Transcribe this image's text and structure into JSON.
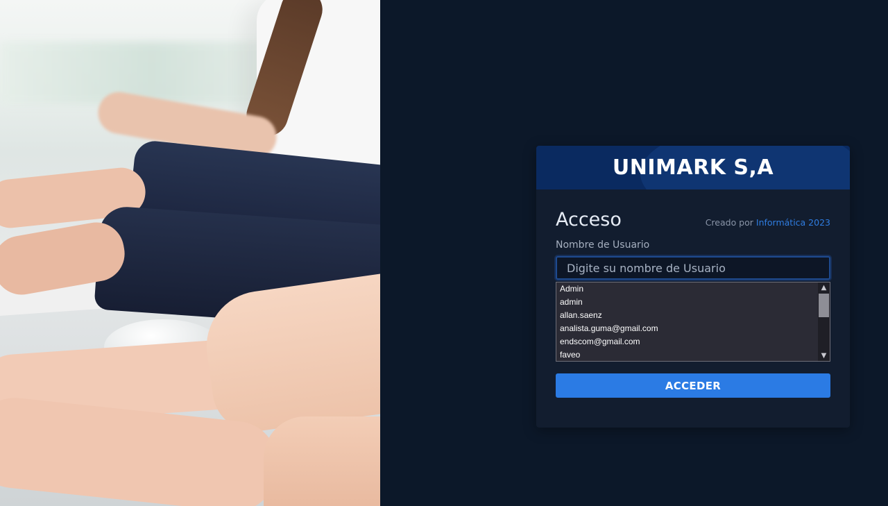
{
  "photo": {
    "description_icon": "office-typing-photo"
  },
  "card": {
    "brand_title": "UNIMARK S,A",
    "heading": "Acceso",
    "credit_prefix": "Creado por ",
    "credit_link": "Informática 2023",
    "username_label": "Nombre de Usuario",
    "username_placeholder": "Digite su nombre de Usuario",
    "username_value": "",
    "autocomplete_options": [
      "Admin",
      "admin",
      "allan.saenz",
      "analista.guma@gmail.com",
      "endscom@gmail.com",
      "faveo"
    ],
    "submit_label": "ACCEDER"
  },
  "colors": {
    "page_background": "#0c1829",
    "card_background": "#121d2f",
    "header_background": "#0a2a60",
    "accent": "#2b7be4",
    "link": "#2f7de1"
  }
}
